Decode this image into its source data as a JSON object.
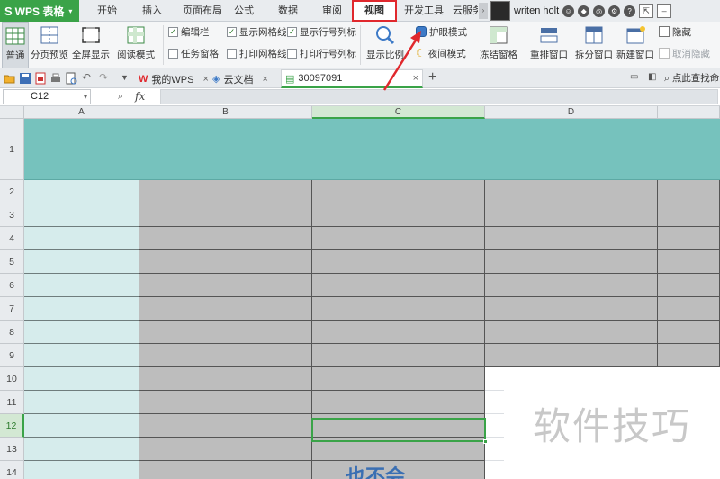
{
  "app": {
    "title": "WPS 表格",
    "logo": "S"
  },
  "tabs": [
    {
      "label": "开始"
    },
    {
      "label": "插入"
    },
    {
      "label": "页面布局"
    },
    {
      "label": "公式"
    },
    {
      "label": "数据"
    },
    {
      "label": "审阅"
    },
    {
      "label": "视图",
      "active": true
    },
    {
      "label": "开发工具"
    },
    {
      "label": "云服务"
    }
  ],
  "user": {
    "name": "writen holt"
  },
  "ribbon": {
    "view_buttons": [
      "普通",
      "分页预览",
      "全屏显示",
      "阅读模式"
    ],
    "checks": [
      {
        "label": "编辑栏",
        "checked": true
      },
      {
        "label": "任务窗格",
        "checked": false
      },
      {
        "label": "显示网格线",
        "checked": true
      },
      {
        "label": "打印网格线",
        "checked": false
      },
      {
        "label": "显示行号列标",
        "checked": true
      },
      {
        "label": "打印行号列标",
        "checked": false
      }
    ],
    "zoom_label": "显示比例",
    "eye_mode": "护眼模式",
    "night_mode": "夜间模式",
    "freeze": "冻结窗格",
    "rearrange": "重排窗口",
    "split": "拆分窗口",
    "new_window": "新建窗口",
    "hide": "隐藏",
    "unhide": "取消隐藏"
  },
  "doc_tabs": [
    {
      "label": "我的WPS"
    },
    {
      "label": "云文档"
    },
    {
      "label": "30097091",
      "active": true
    }
  ],
  "find_label": "点此查找命",
  "formula_bar": {
    "cell_ref": "C12",
    "fx": "fx"
  },
  "sheet": {
    "columns": [
      "A",
      "B",
      "C",
      "D"
    ],
    "rows": [
      "1",
      "2",
      "3",
      "4",
      "5",
      "6",
      "7",
      "8",
      "9",
      "10",
      "11",
      "12",
      "13",
      "14"
    ],
    "active_cell": "C12",
    "partial_text": "也不会"
  },
  "watermark": "软件技巧",
  "colors": {
    "accent_green": "#3aa348",
    "highlight_red": "#e0282d",
    "teal": "#76c2bd",
    "light_teal": "#d6ecec",
    "gray_cell": "#bdbdbd"
  }
}
